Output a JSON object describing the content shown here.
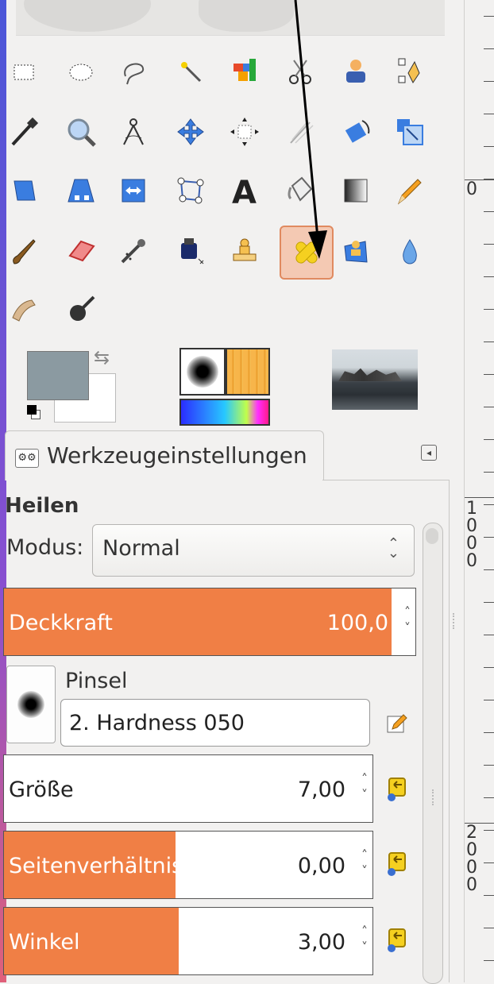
{
  "tab": {
    "title": "Werkzeugeinstellungen",
    "icon_glyph": "⚙⚙"
  },
  "tool_name": "Heilen",
  "modus": {
    "label": "Modus:",
    "value": "Normal"
  },
  "deckkraft": {
    "label": "Deckkraft",
    "value": "100,0",
    "fill_fraction": 1.0
  },
  "pinsel": {
    "label": "Pinsel",
    "value": "2. Hardness 050"
  },
  "groesse": {
    "label": "Größe",
    "value": "7,00",
    "fill_fraction": 0.0
  },
  "seitenverhaeltnis": {
    "label": "Seitenverhältnis",
    "value": "0,00",
    "fill_fraction": 0.5
  },
  "winkel": {
    "label": "Winkel",
    "value": "3,00",
    "fill_fraction": 0.5
  },
  "ruler": {
    "labels": [
      "0",
      "1000",
      "2000"
    ]
  },
  "colors": {
    "foreground": "#8b9aa1",
    "background": "#ffffff",
    "accent": "#f07f45"
  },
  "tools": [
    "rect-select-icon",
    "ellipse-select-icon",
    "free-select-icon",
    "fuzzy-select-icon",
    "select-by-color-icon",
    "scissors-select-icon",
    "foreground-select-icon",
    "paths-icon",
    "color-picker-icon",
    "zoom-icon",
    "measure-icon",
    "move-icon",
    "align-icon",
    "crop-icon",
    "rotate-icon",
    "scale-icon",
    "shear-icon",
    "perspective-icon",
    "flip-icon",
    "cage-transform-icon",
    "text-icon",
    "bucket-fill-icon",
    "blend-icon",
    "pencil-icon",
    "paintbrush-icon",
    "eraser-icon",
    "airbrush-icon",
    "ink-icon",
    "clone-icon",
    "heal-icon",
    "perspective-clone-icon",
    "blur-icon",
    "smudge-icon",
    "dodge-burn-icon"
  ],
  "active_tool": "heal-icon"
}
